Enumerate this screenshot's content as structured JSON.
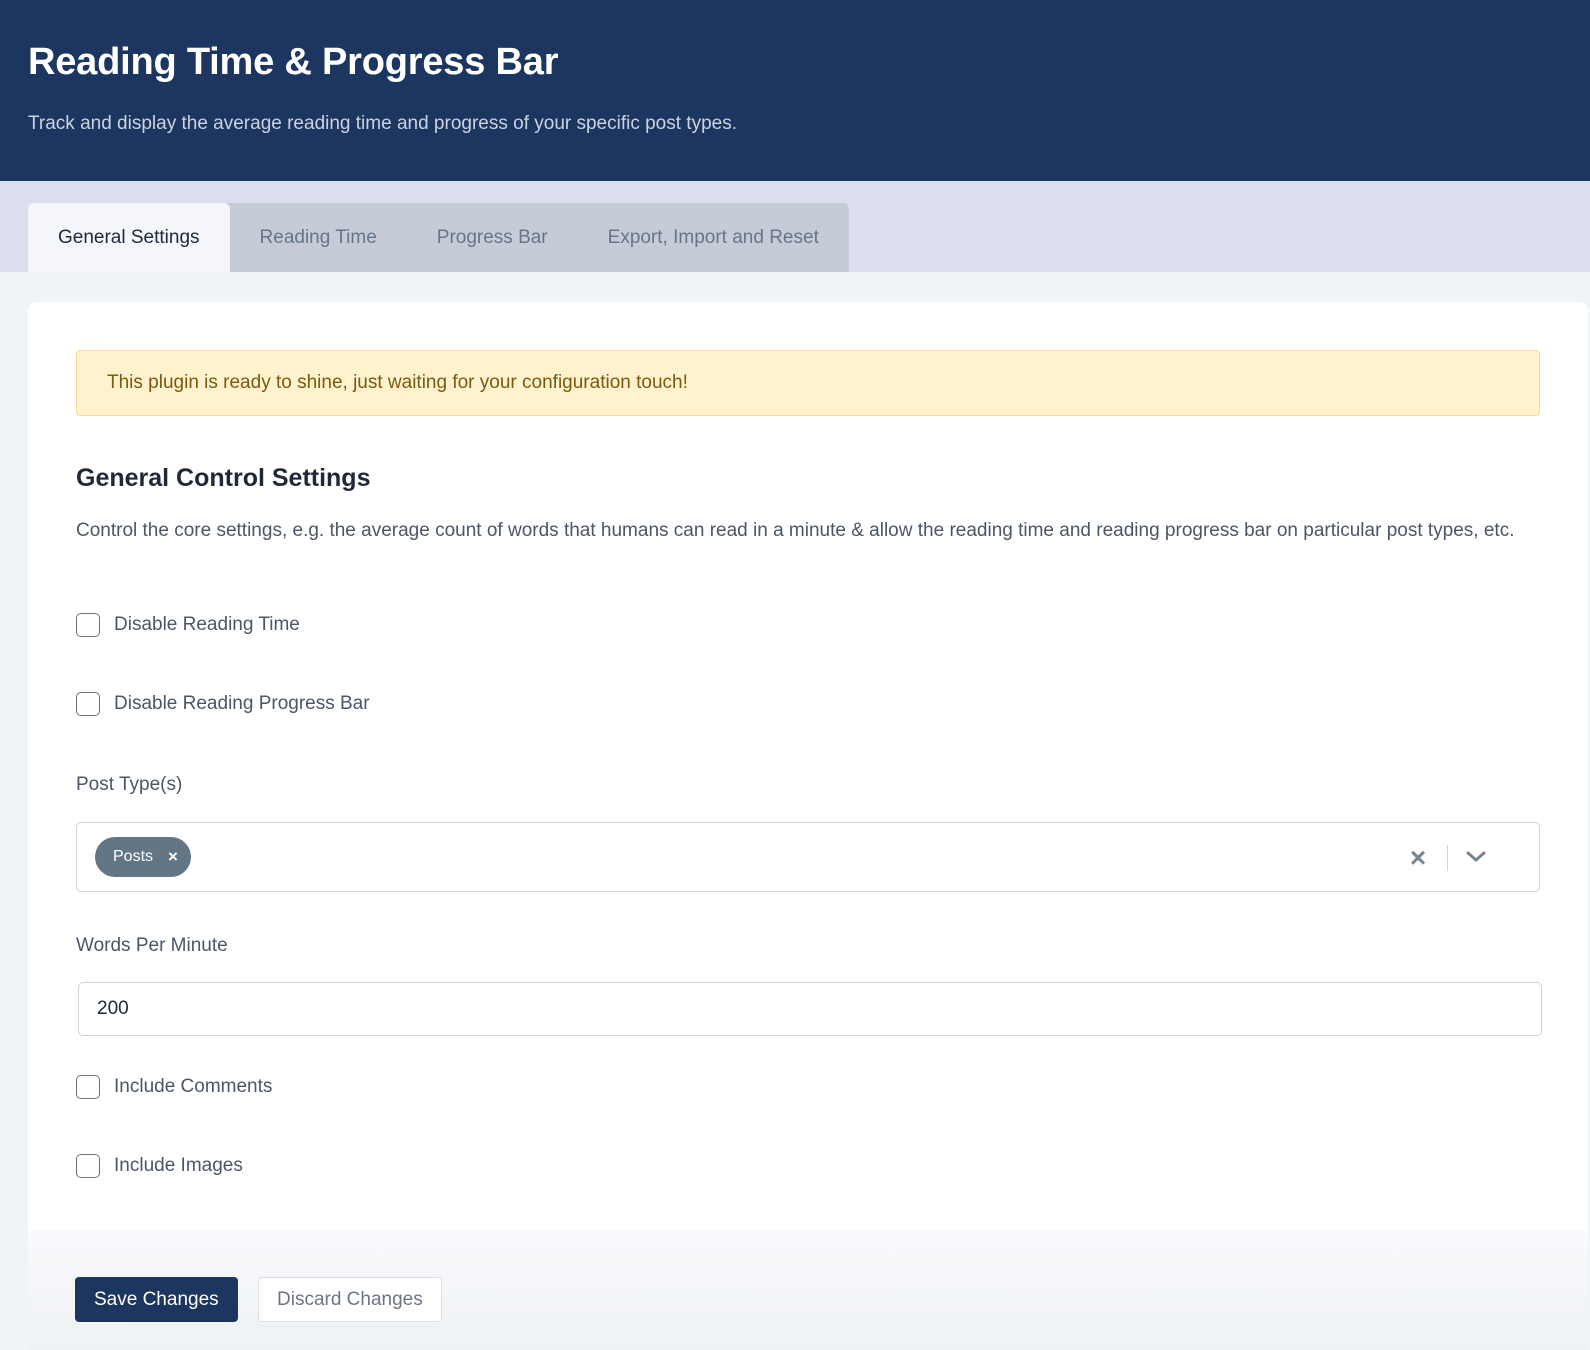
{
  "header": {
    "title": "Reading Time & Progress Bar",
    "subtitle": "Track and display the average reading time and progress of your specific post types."
  },
  "tabs": [
    {
      "label": "General Settings",
      "active": true
    },
    {
      "label": "Reading Time",
      "active": false
    },
    {
      "label": "Progress Bar",
      "active": false
    },
    {
      "label": "Export, Import and Reset",
      "active": false
    }
  ],
  "notice": {
    "text": "This plugin is ready to shine, just waiting for your configuration touch!"
  },
  "section": {
    "title": "General Control Settings",
    "description": "Control the core settings, e.g. the average count of words that humans can read in a minute & allow the reading time and reading progress bar on particular post types, etc."
  },
  "options": {
    "disable_reading_time": {
      "label": "Disable Reading Time",
      "checked": false
    },
    "disable_progress_bar": {
      "label": "Disable Reading Progress Bar",
      "checked": false
    },
    "include_comments": {
      "label": "Include Comments",
      "checked": false
    },
    "include_images": {
      "label": "Include Images",
      "checked": false
    }
  },
  "post_types": {
    "label": "Post Type(s)",
    "selected": [
      "Posts"
    ]
  },
  "words_per_minute": {
    "label": "Words Per Minute",
    "value": "200"
  },
  "footer": {
    "save_label": "Save Changes",
    "discard_label": "Discard Changes"
  },
  "colors": {
    "header_bg": "#1d3660",
    "tabbar_bg": "#dadeee",
    "notice_bg": "#fff2cc",
    "chip_bg": "#627686",
    "primary_button": "#1d3660"
  },
  "icons": {
    "chip_remove": "close-icon",
    "clear_all": "close-icon",
    "dropdown": "chevron-down-icon"
  }
}
